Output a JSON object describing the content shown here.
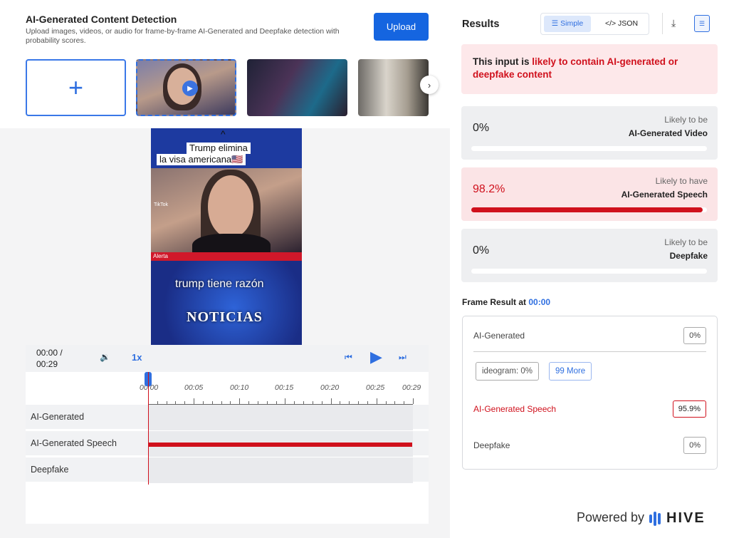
{
  "header": {
    "title": "AI-Generated Content Detection",
    "subtitle": "Upload images, videos, or audio for frame-by-frame AI-Generated and Deepfake detection with probability scores.",
    "upload_label": "Upload"
  },
  "gallery": {
    "add_icon": "+",
    "next_icon": "›",
    "play_icon": "▶",
    "thumb_watermark": "TikTok"
  },
  "video": {
    "caption_line1": "Trump elimina",
    "caption_line2": "la visa americana🇺🇸",
    "collapse_icon": "^",
    "watermark": "TikTok",
    "alert_label": "Alerta",
    "caption_line3": "trump tiene razón",
    "banner": "NOTICIAS"
  },
  "player": {
    "time_current": "00:00 /",
    "time_total": "00:29",
    "speed": "1x",
    "volume_icon": "🔉",
    "prev_icon": "⏮",
    "play_icon": "▶",
    "next_icon": "⏭"
  },
  "timeline": {
    "ticks": [
      "00:00",
      "00:05",
      "00:10",
      "00:15",
      "00:20",
      "00:25",
      "00:29"
    ],
    "tracks": [
      {
        "label": "AI-Generated"
      },
      {
        "label": "AI-Generated Speech"
      },
      {
        "label": "Deepfake"
      }
    ]
  },
  "results": {
    "title": "Results",
    "view_simple": "☰ Simple",
    "view_json": "</> JSON",
    "download_icon": "⤓",
    "doc_icon": "☰",
    "verdict_prefix": "This input is ",
    "verdict_highlight": "likely to contain AI-generated or deepfake content",
    "cards": [
      {
        "pct": "0%",
        "line1": "Likely to be",
        "line2": "AI-Generated Video",
        "fraction": 0
      },
      {
        "pct": "98.2%",
        "line1": "Likely to have",
        "line2": "AI-Generated Speech",
        "fraction": 0.982
      },
      {
        "pct": "0%",
        "line1": "Likely to be",
        "line2": "Deepfake",
        "fraction": 0
      }
    ]
  },
  "frame": {
    "label": "Frame Result at ",
    "time": "00:00",
    "rows": [
      {
        "label": "AI-Generated",
        "value": "0%"
      },
      {
        "label": "AI-Generated Speech",
        "value": "95.9%"
      },
      {
        "label": "Deepfake",
        "value": "0%"
      }
    ],
    "chip1": "ideogram: 0%",
    "chip2": "99 More"
  },
  "footer": {
    "powered_by": "Powered by",
    "brand": "HIVE"
  },
  "colors": {
    "accent": "#2f6fe0",
    "alert": "#d0101c"
  }
}
